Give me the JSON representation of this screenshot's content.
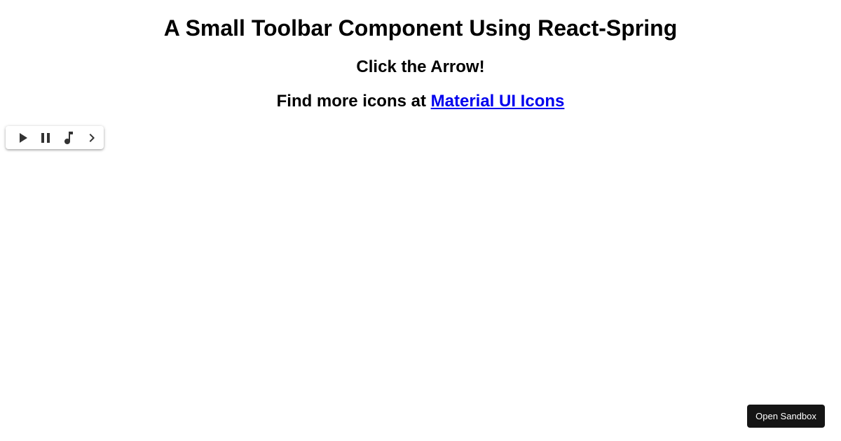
{
  "header": {
    "title": "A Small Toolbar Component Using React-Spring",
    "subtitle": "Click the Arrow!",
    "icons_prefix": "Find more icons at ",
    "icons_link_label": "Material UI Icons"
  },
  "toolbar": {
    "buttons": [
      {
        "icon": "play-icon"
      },
      {
        "icon": "pause-icon"
      },
      {
        "icon": "music-note-icon"
      },
      {
        "icon": "chevron-right-icon"
      }
    ],
    "icon_color": "#333333"
  },
  "footer": {
    "open_sandbox_label": "Open Sandbox",
    "button_color": "#151515"
  },
  "colors": {
    "link": "#0000ee",
    "background": "#ffffff"
  }
}
